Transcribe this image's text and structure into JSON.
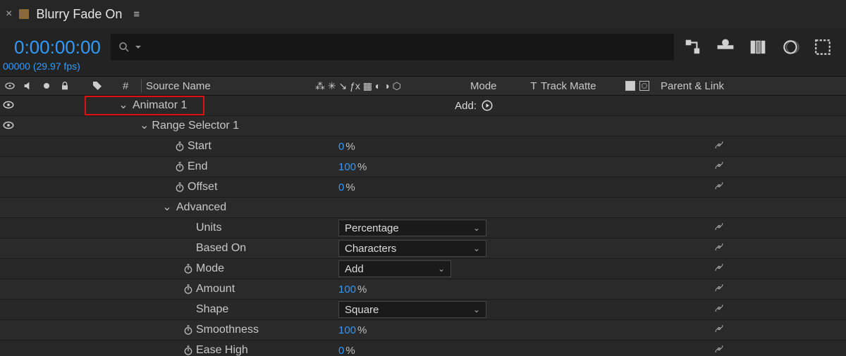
{
  "tab": {
    "title": "Blurry Fade On"
  },
  "time": {
    "code": "0:00:00:00",
    "frames": "00000",
    "fps": "29.97 fps"
  },
  "columns": {
    "hash": "#",
    "sourceName": "Source Name",
    "mode": "Mode",
    "t": "T",
    "trackMatte": "Track Matte",
    "parentLink": "Parent & Link"
  },
  "animator": {
    "label": "Animator 1",
    "addLabel": "Add:",
    "rangeSelector": {
      "label": "Range Selector 1"
    },
    "props": {
      "start": {
        "label": "Start",
        "value": "0",
        "unit": "%"
      },
      "end": {
        "label": "End",
        "value": "100",
        "unit": "%"
      },
      "offset": {
        "label": "Offset",
        "value": "0",
        "unit": "%"
      }
    },
    "advanced": {
      "label": "Advanced",
      "units": {
        "label": "Units",
        "value": "Percentage"
      },
      "basedOn": {
        "label": "Based On",
        "value": "Characters"
      },
      "mode": {
        "label": "Mode",
        "value": "Add"
      },
      "amount": {
        "label": "Amount",
        "value": "100",
        "unit": "%"
      },
      "shape": {
        "label": "Shape",
        "value": "Square"
      },
      "smoothness": {
        "label": "Smoothness",
        "value": "100",
        "unit": "%"
      },
      "easeHigh": {
        "label": "Ease High",
        "value": "0",
        "unit": "%"
      }
    }
  }
}
